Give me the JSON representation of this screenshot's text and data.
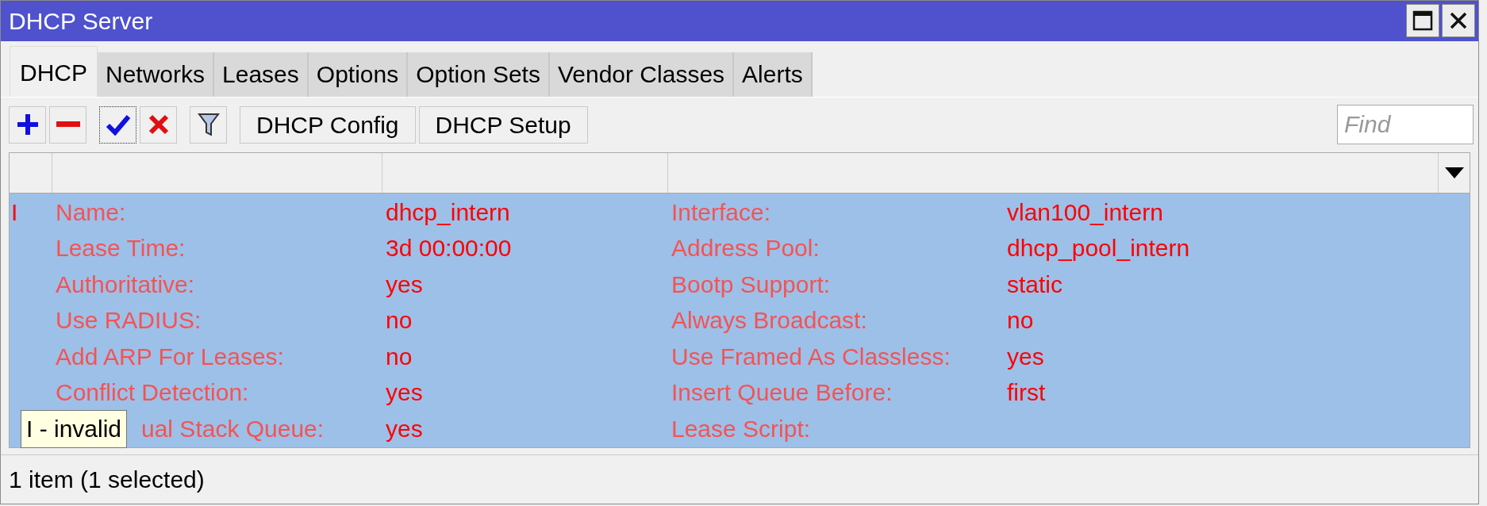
{
  "window": {
    "title": "DHCP Server"
  },
  "tabs": [
    {
      "label": "DHCP",
      "selected": true
    },
    {
      "label": "Networks",
      "selected": false
    },
    {
      "label": "Leases",
      "selected": false
    },
    {
      "label": "Options",
      "selected": false
    },
    {
      "label": "Option Sets",
      "selected": false
    },
    {
      "label": "Vendor Classes",
      "selected": false
    },
    {
      "label": "Alerts",
      "selected": false
    }
  ],
  "toolbar": {
    "buttons": [
      "DHCP Config",
      "DHCP Setup"
    ],
    "search": {
      "placeholder": "Find"
    }
  },
  "table": {
    "rows": [
      {
        "marker": "I",
        "selected": true,
        "lines": [
          {
            "label": "Name:",
            "value": "dhcp_intern",
            "label_2": "Interface:",
            "value_2": "vlan100_intern"
          },
          {
            "label": "Lease Time:",
            "value": "3d 00:00:00",
            "label_2": "Address Pool:",
            "value_2": "dhcp_pool_intern"
          },
          {
            "label": "Authoritative:",
            "value": "yes",
            "label_2": "Bootp Support:",
            "value_2": "static"
          },
          {
            "label": "Use RADIUS:",
            "value": "no",
            "label_2": "Always Broadcast:",
            "value_2": "no"
          },
          {
            "label": "Add ARP For Leases:",
            "value": "no",
            "label_2": "Use Framed As Classless:",
            "value_2": "yes"
          },
          {
            "label": "Conflict Detection:",
            "value": "yes",
            "label_2": "Insert Queue Before:",
            "value_2": "first"
          },
          {
            "label": "ual Stack Queue:",
            "value": "yes",
            "label_2": "Lease Script:",
            "under_tooltip": true
          }
        ]
      }
    ]
  },
  "tooltip": "I - invalid",
  "status_bar": "1 item (1 selected)"
}
